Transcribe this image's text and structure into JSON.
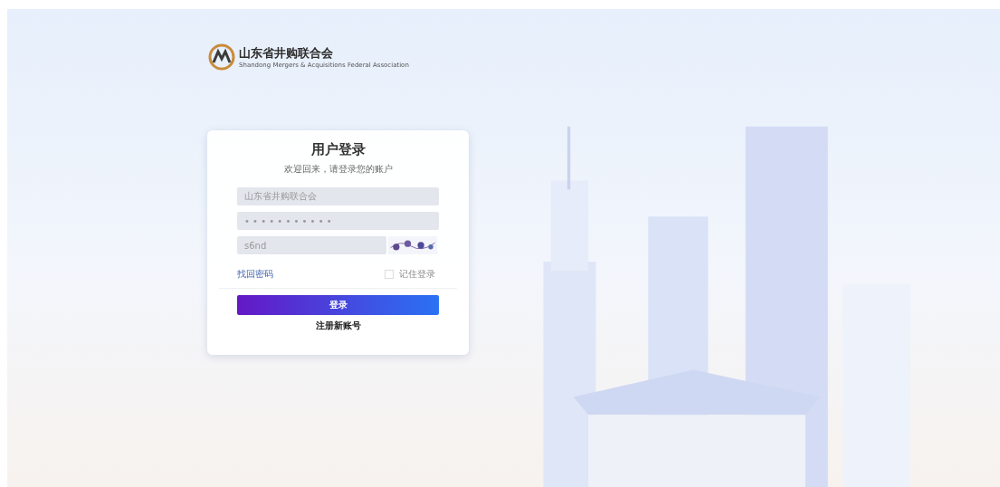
{
  "brand": {
    "name": "山东省井购联合会",
    "subtitle": "Shandong Mergers & Acquisitions Federal Association"
  },
  "login": {
    "title": "用户登录",
    "subtitle": "欢迎回来，请登录您的账户",
    "fields": [
      {
        "kind": "text",
        "value": "山东省井购联合会"
      },
      {
        "kind": "password",
        "value": "• • • • • • • • • • •"
      },
      {
        "kind": "captcha",
        "value": "s6nd"
      }
    ],
    "forgot_link": "找回密码",
    "remember": {
      "label": "记住登录",
      "checked": false
    },
    "submit": "登录",
    "register_link": "注册新账号"
  }
}
